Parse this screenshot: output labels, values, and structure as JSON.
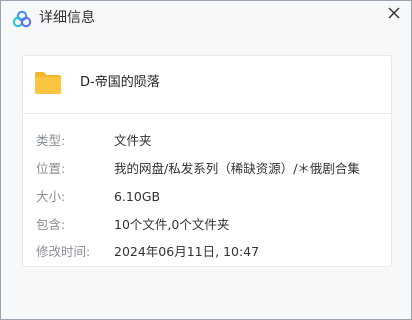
{
  "window": {
    "title": "详细信息"
  },
  "file": {
    "name": "D-帝国的陨落",
    "icon": "folder-icon",
    "icon_color": "#f9c43f"
  },
  "details": [
    {
      "label": "类型:",
      "value": "文件夹"
    },
    {
      "label": "位置:",
      "value": "我的网盘/私发系列（稀缺资源）/＊俄剧合集"
    },
    {
      "label": "大小:",
      "value": "6.10GB"
    },
    {
      "label": "包含:",
      "value": "10个文件,0个文件夹"
    },
    {
      "label": "修改时间:",
      "value": "2024年06月11日, 10:47"
    }
  ],
  "colors": {
    "accent": "#3b8cff",
    "label_text": "#8a8f96",
    "value_text": "#333333"
  }
}
